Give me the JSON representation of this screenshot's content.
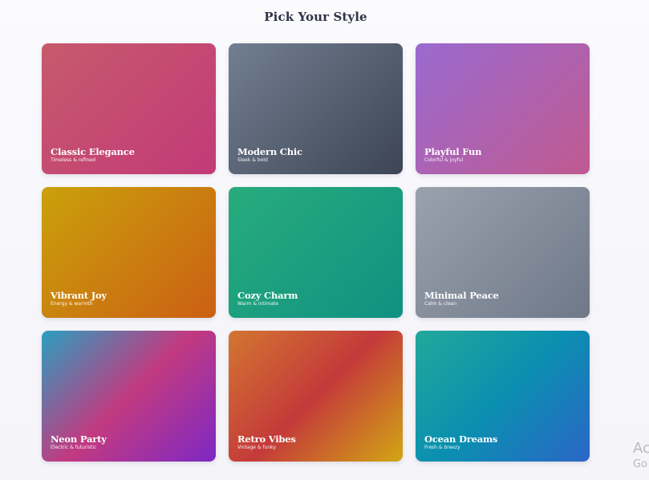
{
  "page": {
    "title": "Pick Your Style"
  },
  "cards": [
    {
      "title": "Classic Elegance",
      "subtitle": "Timeless & refined",
      "gradient": [
        "#c75a6c",
        "#c23a78"
      ]
    },
    {
      "title": "Modern Chic",
      "subtitle": "Sleek & bold",
      "gradient": [
        "#727f92",
        "#3d4554"
      ]
    },
    {
      "title": "Playful Fun",
      "subtitle": "Colorful & joyful",
      "gradient": [
        "#9a6ad0",
        "#c05a90"
      ]
    },
    {
      "title": "Vibrant Joy",
      "subtitle": "Energy & warmth",
      "gradient": [
        "#caa10b",
        "#cb5f14"
      ]
    },
    {
      "title": "Cozy Charm",
      "subtitle": "Warm & intimate",
      "gradient": [
        "#28ac7c",
        "#0f9182"
      ]
    },
    {
      "title": "Minimal Peace",
      "subtitle": "Calm & clean",
      "gradient": [
        "#9aa2ae",
        "#6f7888"
      ]
    },
    {
      "title": "Neon Party",
      "subtitle": "Electric & futuristic",
      "gradient": [
        "#2a9fc0",
        "#c23a80",
        "#7d28c5"
      ]
    },
    {
      "title": "Retro Vibes",
      "subtitle": "Vintage & funky",
      "gradient": [
        "#d37631",
        "#c43a3a",
        "#d2a614"
      ]
    },
    {
      "title": "Ocean Dreams",
      "subtitle": "Fresh & breezy",
      "gradient": [
        "#22a89a",
        "#0a8fb0",
        "#2b66c7"
      ]
    }
  ],
  "watermark": {
    "line1": "Ac",
    "line2": "Go"
  }
}
